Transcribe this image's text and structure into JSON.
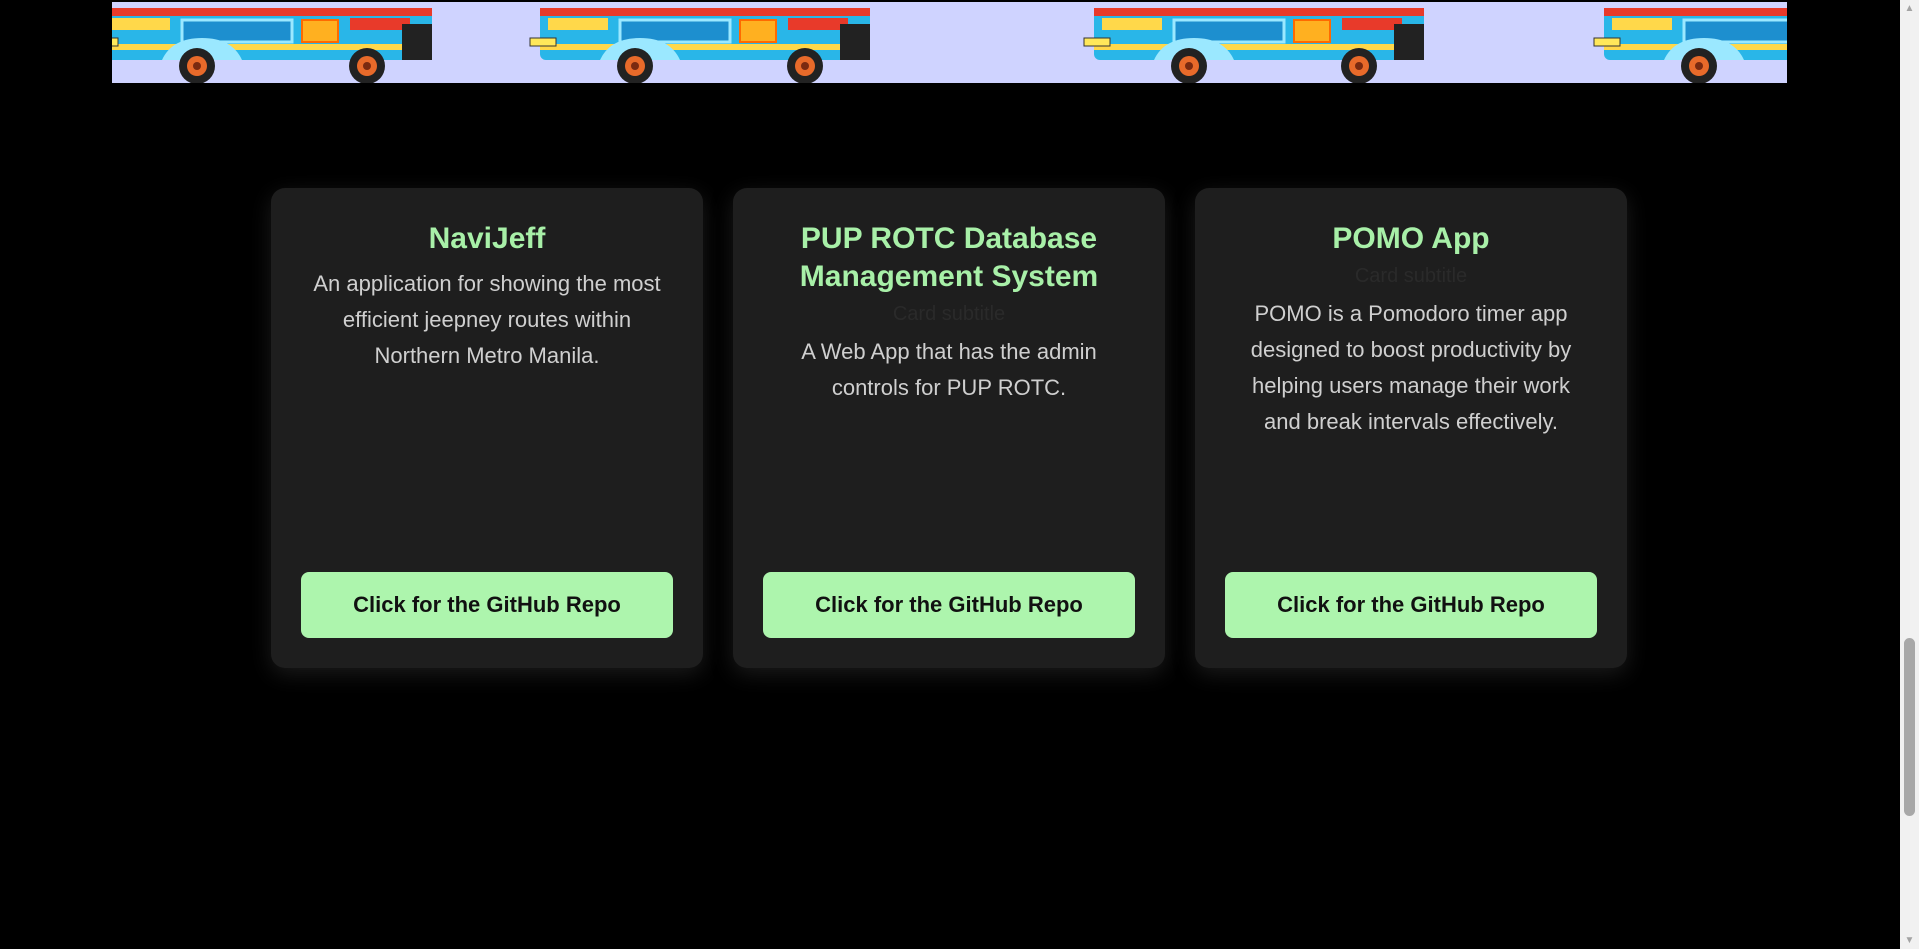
{
  "cards": [
    {
      "title": "NaviJeff",
      "subtitle": "",
      "description": "An application for showing the most efficient jeepney routes within Northern Metro Manila.",
      "button_label": "Click for the GitHub Repo"
    },
    {
      "title": "PUP ROTC Database Management System",
      "subtitle": "Card subtitle",
      "description": "A Web App that has the admin controls for PUP ROTC.",
      "button_label": "Click for the GitHub Repo"
    },
    {
      "title": "POMO App",
      "subtitle": "Card subtitle",
      "description": "POMO is a Pomodoro timer app designed to boost productivity by helping users manage their work and break intervals effectively.",
      "button_label": "Click for the GitHub Repo"
    }
  ],
  "scrollbar": {
    "up_icon": "arrow-up-icon",
    "down_icon": "arrow-down-icon",
    "position_fraction": 0.78
  },
  "colors": {
    "background": "#000000",
    "card_background": "#1e1e1e",
    "accent_green": "#a8f0a8",
    "button_green": "#adf5ad",
    "banner_sky": "#cfd3ff"
  }
}
